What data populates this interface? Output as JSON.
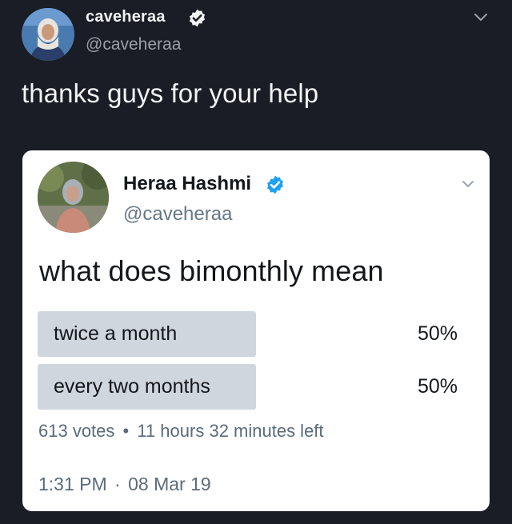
{
  "outer_tweet": {
    "display_name": "caveheraa",
    "handle": "@caveheraa",
    "text": "thanks guys for your help",
    "avatar_icon": "profile-photo",
    "verified_icon": "verified-badge-icon",
    "menu_icon": "chevron-down-icon"
  },
  "quoted_tweet": {
    "display_name": "Heraa Hashmi",
    "handle": "@caveheraa",
    "text": "what does bimonthly mean",
    "avatar_icon": "profile-photo",
    "verified_icon": "verified-badge-icon",
    "menu_icon": "chevron-down-icon",
    "poll": {
      "options": [
        {
          "label": "twice a month",
          "percent": "50%",
          "fill_fraction": 0.5
        },
        {
          "label": "every two months",
          "percent": "50%",
          "fill_fraction": 0.5
        }
      ],
      "votes": "613 votes",
      "separator": "•",
      "time_left": "11 hours 32 minutes left"
    },
    "timestamp": {
      "time": "1:31 PM",
      "separator": "·",
      "date": "08 Mar 19"
    }
  },
  "colors": {
    "background": "#1a1d26",
    "card": "#ffffff",
    "verified_blue": "#1da1f2",
    "poll_bar": "#cfd6de"
  }
}
